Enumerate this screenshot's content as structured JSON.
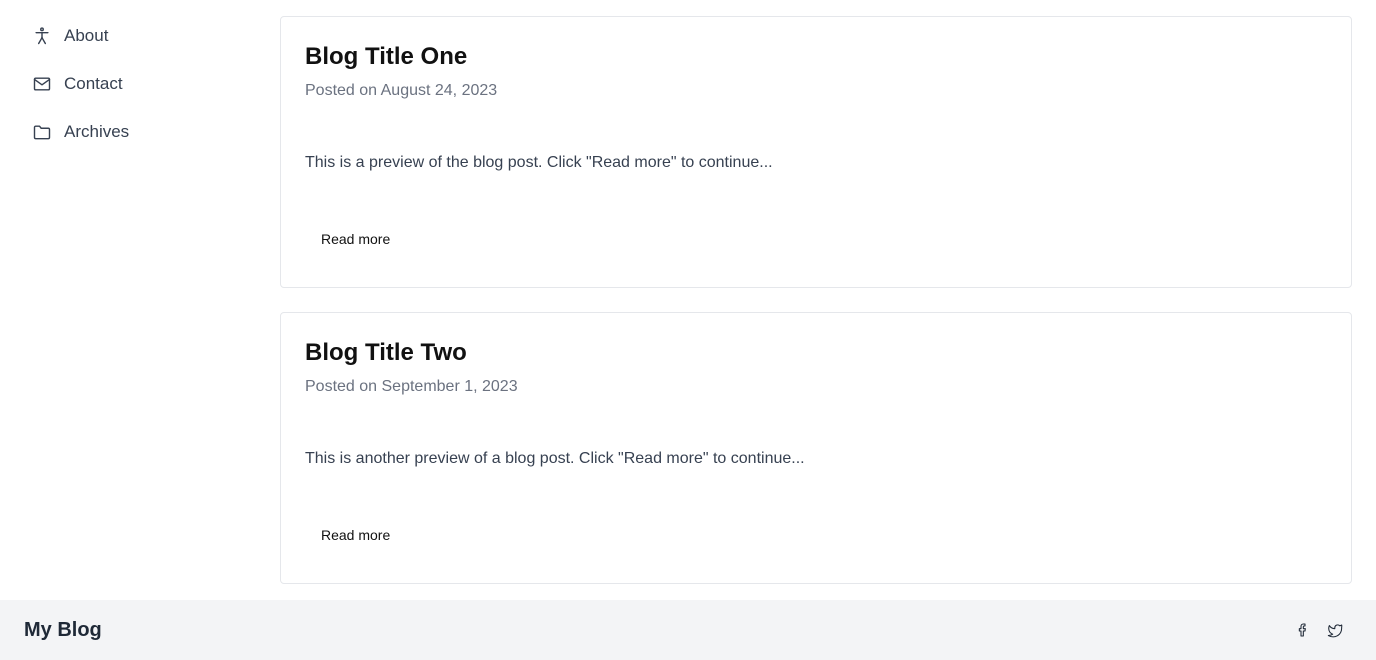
{
  "sidebar": {
    "items": [
      {
        "label": "About",
        "icon": "accessibility-icon"
      },
      {
        "label": "Contact",
        "icon": "mail-icon"
      },
      {
        "label": "Archives",
        "icon": "folder-icon"
      }
    ]
  },
  "posts": [
    {
      "title": "Blog Title One",
      "date": "Posted on August 24, 2023",
      "preview": "This is a preview of the blog post. Click \"Read more\" to continue...",
      "read_more": "Read more"
    },
    {
      "title": "Blog Title Two",
      "date": "Posted on September 1, 2023",
      "preview": "This is another preview of a blog post. Click \"Read more\" to continue...",
      "read_more": "Read more"
    }
  ],
  "footer": {
    "brand": "My Blog",
    "social": [
      {
        "icon": "facebook-icon"
      },
      {
        "icon": "twitter-icon"
      }
    ]
  },
  "colors": {
    "footer_bg": "#f3f4f6",
    "card_border": "#e5e7eb",
    "muted_text": "#6b7280"
  }
}
